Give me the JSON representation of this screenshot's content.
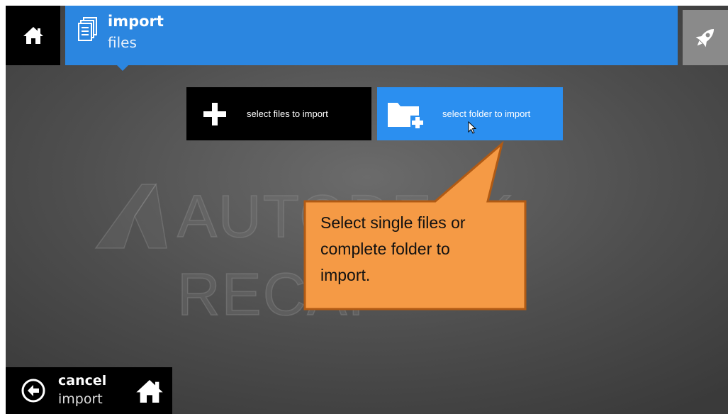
{
  "header": {
    "title": "import",
    "subtitle": "files"
  },
  "actions": {
    "select_files_label": "select files to import",
    "select_folder_label": "select folder to import"
  },
  "watermark": {
    "text": "AUTODESK RECAP"
  },
  "callout": {
    "lines": [
      "Select single files or",
      "complete folder to",
      "import."
    ]
  },
  "footer": {
    "cancel_title": "cancel",
    "cancel_subtitle": "import"
  },
  "icons": {
    "home": "home-icon",
    "import": "documents-icon",
    "rocket": "rocket-icon",
    "plus": "plus-icon",
    "folder_add": "folder-add-icon",
    "back": "back-arrow-icon",
    "cursor": "cursor-icon"
  },
  "colors": {
    "accent_blue": "#2b86e0",
    "folder_button_blue": "#2b8ff0",
    "callout_fill": "#f59a45",
    "callout_border": "#b05a14"
  }
}
